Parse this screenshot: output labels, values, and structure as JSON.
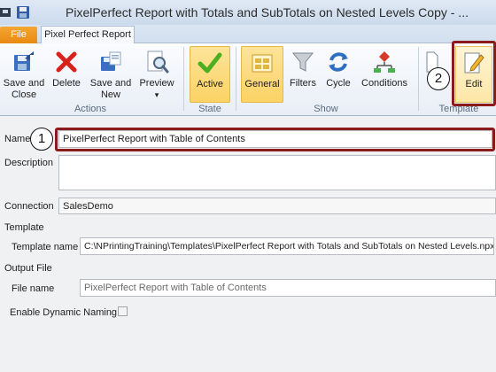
{
  "window": {
    "title": "PixelPerfect Report with Totals and SubTotals on Nested Levels Copy - ..."
  },
  "ribbon": {
    "file_tab": "File",
    "active_tab": "Pixel Perfect Report",
    "groups": {
      "actions": {
        "label": "Actions",
        "buttons": [
          {
            "line1": "Save and",
            "line2": "Close",
            "icon": "save-close-icon"
          },
          {
            "line1": "Delete",
            "line2": "",
            "icon": "delete-icon"
          },
          {
            "line1": "Save and",
            "line2": "New",
            "icon": "save-new-icon"
          },
          {
            "line1": "Preview",
            "line2": "▾",
            "icon": "preview-icon"
          }
        ]
      },
      "state": {
        "label": "State",
        "buttons": [
          {
            "line1": "Active",
            "line2": "",
            "icon": "checkmark-icon",
            "selected": true
          }
        ]
      },
      "show": {
        "label": "Show",
        "buttons": [
          {
            "line1": "General",
            "line2": "",
            "icon": "general-icon",
            "selected": true
          },
          {
            "line1": "Filters",
            "line2": "",
            "icon": "filter-icon"
          },
          {
            "line1": "Cycle",
            "line2": "",
            "icon": "cycle-icon"
          },
          {
            "line1": "Conditions",
            "line2": "",
            "icon": "conditions-icon"
          }
        ]
      },
      "template": {
        "label": "Template",
        "buttons": [
          {
            "line1": "Edit",
            "line2": "",
            "icon": "edit-icon"
          }
        ]
      }
    }
  },
  "form": {
    "name_label": "Name",
    "name_value": "PixelPerfect Report with Table of Contents",
    "description_label": "Description",
    "description_value": "",
    "connection_label": "Connection",
    "connection_value": "SalesDemo",
    "template_section": "Template",
    "template_name_label": "Template name",
    "template_name_value": "C:\\NPrintingTraining\\Templates\\PixelPerfect Report with Totals and SubTotals on Nested Levels.npx",
    "output_section": "Output File",
    "file_name_label": "File name",
    "file_name_value": "PixelPerfect Report with Table of Contents",
    "dynamic_naming_label": "Enable Dynamic Naming",
    "dynamic_naming_checked": false
  },
  "callouts": [
    "1",
    "2"
  ],
  "colors": {
    "callout": "#8b1a1a",
    "file_tab": "#f0961e",
    "selected_button": "#fbd264",
    "active_check": "#4caf20"
  }
}
